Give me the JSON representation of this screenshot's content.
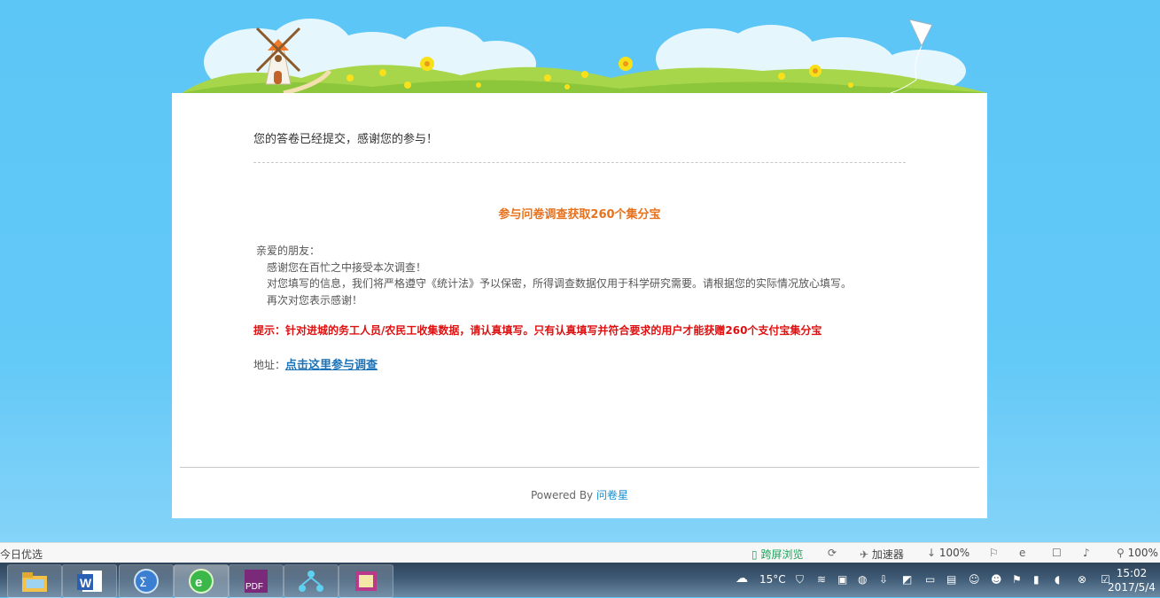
{
  "page": {
    "message": "您的答卷已经提交，感谢您的参与！",
    "promo_title": "参与问卷调查获取260个集分宝",
    "letter": {
      "greeting": "亲爱的朋友：",
      "lines": [
        "感谢您在百忙之中接受本次调查！",
        "对您填写的信息，我们将严格遵守《统计法》予以保密，所得调查数据仅用于科学研究需要。请根据您的实际情况放心填写。",
        "再次对您表示感谢！"
      ]
    },
    "tip": "提示：针对进城的务工人员/农民工收集数据，请认真填写。只有认真填写并符合要求的用户才能获赠260个支付宝集分宝",
    "address_label": "地址：",
    "address_link": "点击这里参与调查",
    "powered_by": "Powered By",
    "powered_link": "问卷星"
  },
  "statusbar": {
    "left_text": "今日优选",
    "cross_screen": "跨屏浏览",
    "accelerator": "加速器",
    "download_pct": "100%",
    "zoom": "100%"
  },
  "taskbar": {
    "apps": [
      "file-explorer-icon",
      "word-icon",
      "math-icon",
      "browser-icon",
      "pdf-icon",
      "network-icon",
      "book-icon"
    ],
    "weather_temp": "15°C",
    "time": "15:02",
    "date": "2017/5/4"
  },
  "colors": {
    "sky": "#5cc6f6",
    "orange": "#e8711c",
    "red": "#e01010",
    "link": "#1a73b8"
  }
}
